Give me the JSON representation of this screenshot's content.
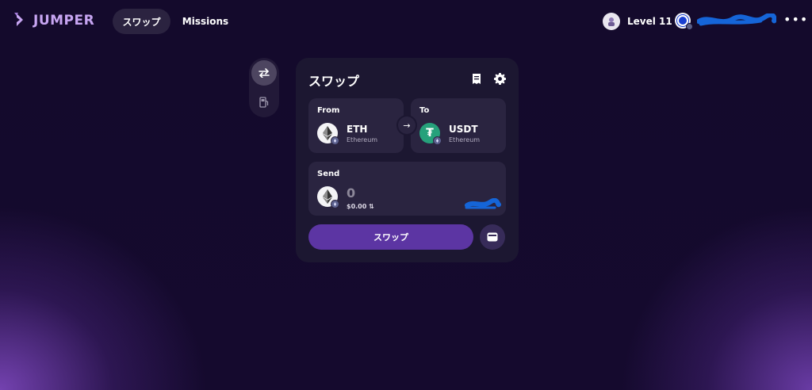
{
  "header": {
    "logo_text": "JUMPER",
    "nav": [
      {
        "label": "スワップ",
        "active": true
      },
      {
        "label": "Missions",
        "active": false
      }
    ],
    "level_label": "Level 11",
    "more_label": "•••"
  },
  "rail": {
    "items": [
      {
        "icon": "swap-arrows-icon",
        "active": true
      },
      {
        "icon": "gas-pump-icon",
        "active": false
      }
    ]
  },
  "card": {
    "title": "スワップ",
    "from": {
      "label": "From",
      "token_symbol": "ETH",
      "chain_name": "Ethereum",
      "token_icon": "ethereum-icon"
    },
    "to": {
      "label": "To",
      "token_symbol": "USDT",
      "chain_name": "Ethereum",
      "token_icon": "tether-icon",
      "token_glyph": "₮"
    },
    "send": {
      "label": "Send",
      "amount": "0",
      "usd_value": "$0.00",
      "toggle_glyph": "⇅"
    },
    "swap_button_label": "スワップ",
    "arrow_glyph": "→"
  },
  "colors": {
    "background": "#150a2e",
    "card": "#1c1731",
    "panel": "#2a2440",
    "accent": "#5c35a3",
    "logo": "#c7a5f2",
    "usdt": "#26a17b",
    "redaction": "#1565d8"
  }
}
